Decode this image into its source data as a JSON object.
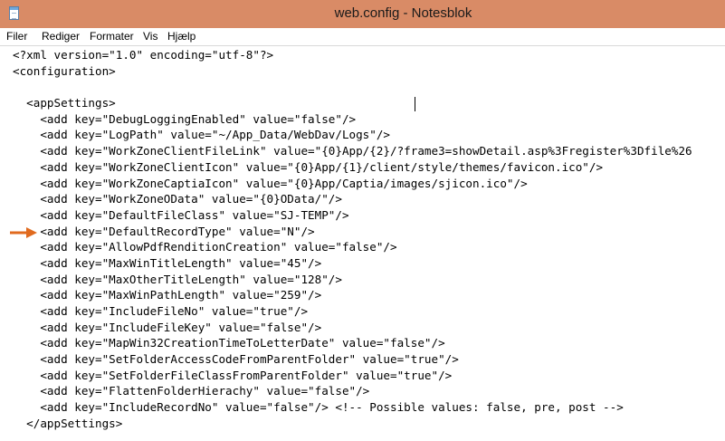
{
  "window": {
    "title": "web.config - Notesblok"
  },
  "icons": {
    "app": "notepad-icon",
    "annotation": "arrow-right-icon",
    "annotation_color": "#e06a1e"
  },
  "menu": {
    "items": [
      "Filer",
      "Rediger",
      "Formater",
      "Vis",
      "Hjælp"
    ]
  },
  "editor": {
    "lines": [
      "<?xml version=\"1.0\" encoding=\"utf-8\"?>",
      "<configuration>",
      "",
      "  <appSettings>",
      "    <add key=\"DebugLoggingEnabled\" value=\"false\"/>",
      "    <add key=\"LogPath\" value=\"~/App_Data/WebDav/Logs\"/>",
      "    <add key=\"WorkZoneClientFileLink\" value=\"{0}App/{2}/?frame3=showDetail.asp%3Fregister%3Dfile%26",
      "    <add key=\"WorkZoneClientIcon\" value=\"{0}App/{1}/client/style/themes/favicon.ico\"/>",
      "    <add key=\"WorkZoneCaptiaIcon\" value=\"{0}App/Captia/images/sjicon.ico\"/>",
      "    <add key=\"WorkZoneOData\" value=\"{0}OData/\"/>",
      "    <add key=\"DefaultFileClass\" value=\"SJ-TEMP\"/>",
      "    <add key=\"DefaultRecordType\" value=\"N\"/>",
      "    <add key=\"AllowPdfRenditionCreation\" value=\"false\"/>",
      "    <add key=\"MaxWinTitleLength\" value=\"45\"/>",
      "    <add key=\"MaxOtherTitleLength\" value=\"128\"/>",
      "    <add key=\"MaxWinPathLength\" value=\"259\"/>",
      "    <add key=\"IncludeFileNo\" value=\"true\"/>",
      "    <add key=\"IncludeFileKey\" value=\"false\"/>",
      "    <add key=\"MapWin32CreationTimeToLetterDate\" value=\"false\"/>",
      "    <add key=\"SetFolderAccessCodeFromParentFolder\" value=\"true\"/>",
      "    <add key=\"SetFolderFileClassFromParentFolder\" value=\"true\"/>",
      "    <add key=\"FlattenFolderHierachy\" value=\"false\"/>",
      "    <add key=\"IncludeRecordNo\" value=\"false\"/> <!-- Possible values: false, pre, post -->",
      "  </appSettings>"
    ]
  }
}
